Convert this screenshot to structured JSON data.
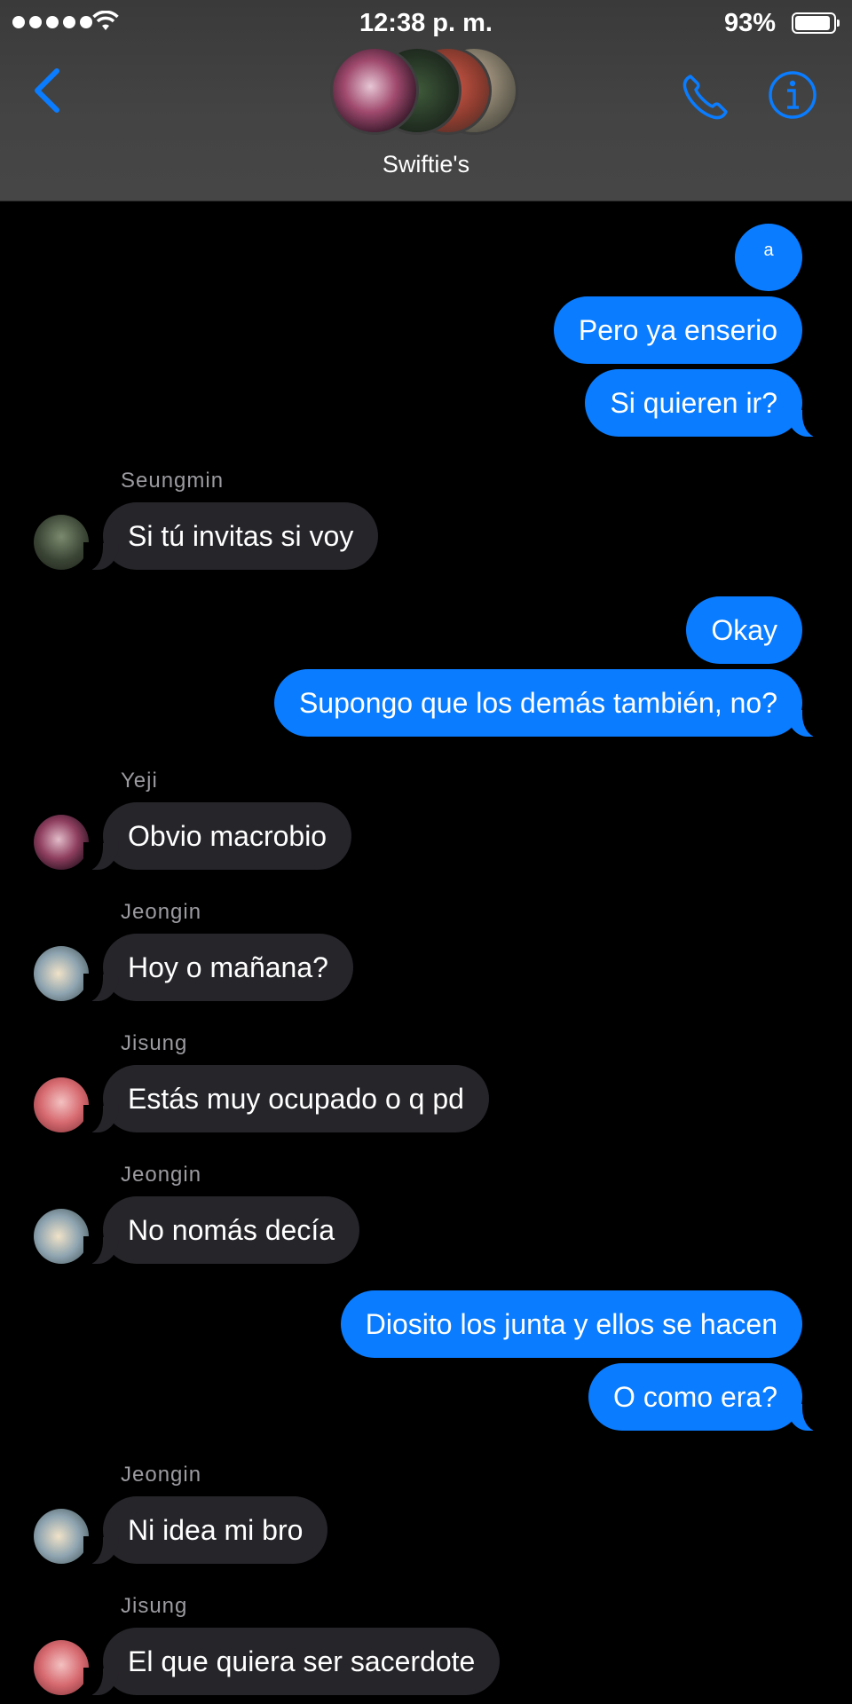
{
  "status": {
    "time": "12:38 p. m.",
    "battery_pct": "93%",
    "battery_level": 0.93,
    "signal_bars": 5
  },
  "header": {
    "group_name": "Swiftie's",
    "accent": "#0a7cff",
    "icons": [
      "back-chevron-icon",
      "phone-icon",
      "info-icon"
    ]
  },
  "messages": [
    {
      "dir": "out",
      "text": "a"
    },
    {
      "dir": "out",
      "text": "Pero ya enserio"
    },
    {
      "dir": "out",
      "text": "Si quieren ir?"
    },
    {
      "dir": "in",
      "sender": "Seungmin",
      "text": "Si tú invitas si voy"
    },
    {
      "dir": "out",
      "text": "Okay"
    },
    {
      "dir": "out",
      "text": "Supongo que los demás también, no?"
    },
    {
      "dir": "in",
      "sender": "Yeji",
      "text": "Obvio macrobio"
    },
    {
      "dir": "in",
      "sender": "Jeongin",
      "text": "Hoy o mañana?"
    },
    {
      "dir": "in",
      "sender": "Jisung",
      "text": "Estás muy ocupado o q pd"
    },
    {
      "dir": "in",
      "sender": "Jeongin",
      "text": "No nomás decía"
    },
    {
      "dir": "out",
      "text": "Diosito los junta y ellos se hacen"
    },
    {
      "dir": "out",
      "text": "O como era?"
    },
    {
      "dir": "in",
      "sender": "Jeongin",
      "text": "Ni idea mi bro"
    },
    {
      "dir": "in",
      "sender": "Jisung",
      "text": "El que quiera ser sacerdote"
    }
  ]
}
